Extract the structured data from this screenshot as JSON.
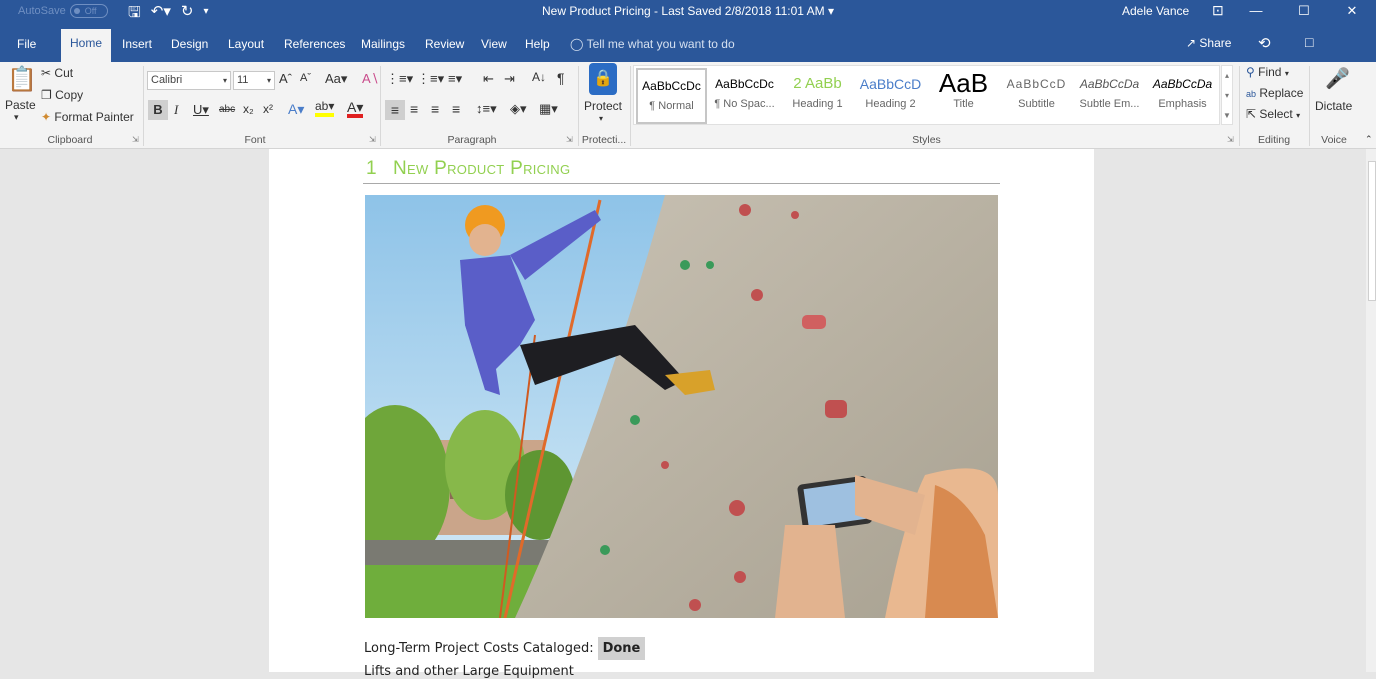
{
  "titlebar": {
    "autosave_label": "AutoSave",
    "autosave_state": "Off",
    "doc_title": "New Product Pricing  -  Last Saved 2/8/2018 11:01 AM",
    "user": "Adele Vance"
  },
  "tabs": [
    "File",
    "Home",
    "Insert",
    "Design",
    "Layout",
    "References",
    "Mailings",
    "Review",
    "View",
    "Help"
  ],
  "tellme": "Tell me what you want to do",
  "share_label": "Share",
  "clipboard": {
    "paste": "Paste",
    "cut": "Cut",
    "copy": "Copy",
    "format_painter": "Format Painter",
    "group": "Clipboard"
  },
  "font": {
    "name": "Calibri",
    "size": "11",
    "group": "Font"
  },
  "paragraph_group": "Paragraph",
  "protect": {
    "label": "Protect",
    "group": "Protecti..."
  },
  "styles": {
    "group": "Styles",
    "items": [
      {
        "preview": "AaBbCcDc",
        "name": "¶ Normal"
      },
      {
        "preview": "AaBbCcDc",
        "name": "¶ No Spac..."
      },
      {
        "preview": "2  AaBb",
        "name": "Heading 1"
      },
      {
        "preview": "AaBbCcD",
        "name": "Heading 2"
      },
      {
        "preview": "AaB",
        "name": "Title"
      },
      {
        "preview": "AaBbCcD",
        "name": "Subtitle"
      },
      {
        "preview": "AaBbCcDa",
        "name": "Subtle Em..."
      },
      {
        "preview": "AaBbCcDa",
        "name": "Emphasis"
      }
    ]
  },
  "editing": {
    "find": "Find",
    "replace": "Replace",
    "select": "Select",
    "group": "Editing"
  },
  "voice": {
    "dictate": "Dictate",
    "group": "Voice"
  },
  "document": {
    "heading_number": "1",
    "heading_text": "New Product Pricing",
    "line1": "Long-Term Project Costs Cataloged:",
    "line1_status": "Done",
    "line2": "Lifts and other Large Equipment"
  },
  "colors": {
    "brand": "#2b579a",
    "heading": "#92d050"
  }
}
